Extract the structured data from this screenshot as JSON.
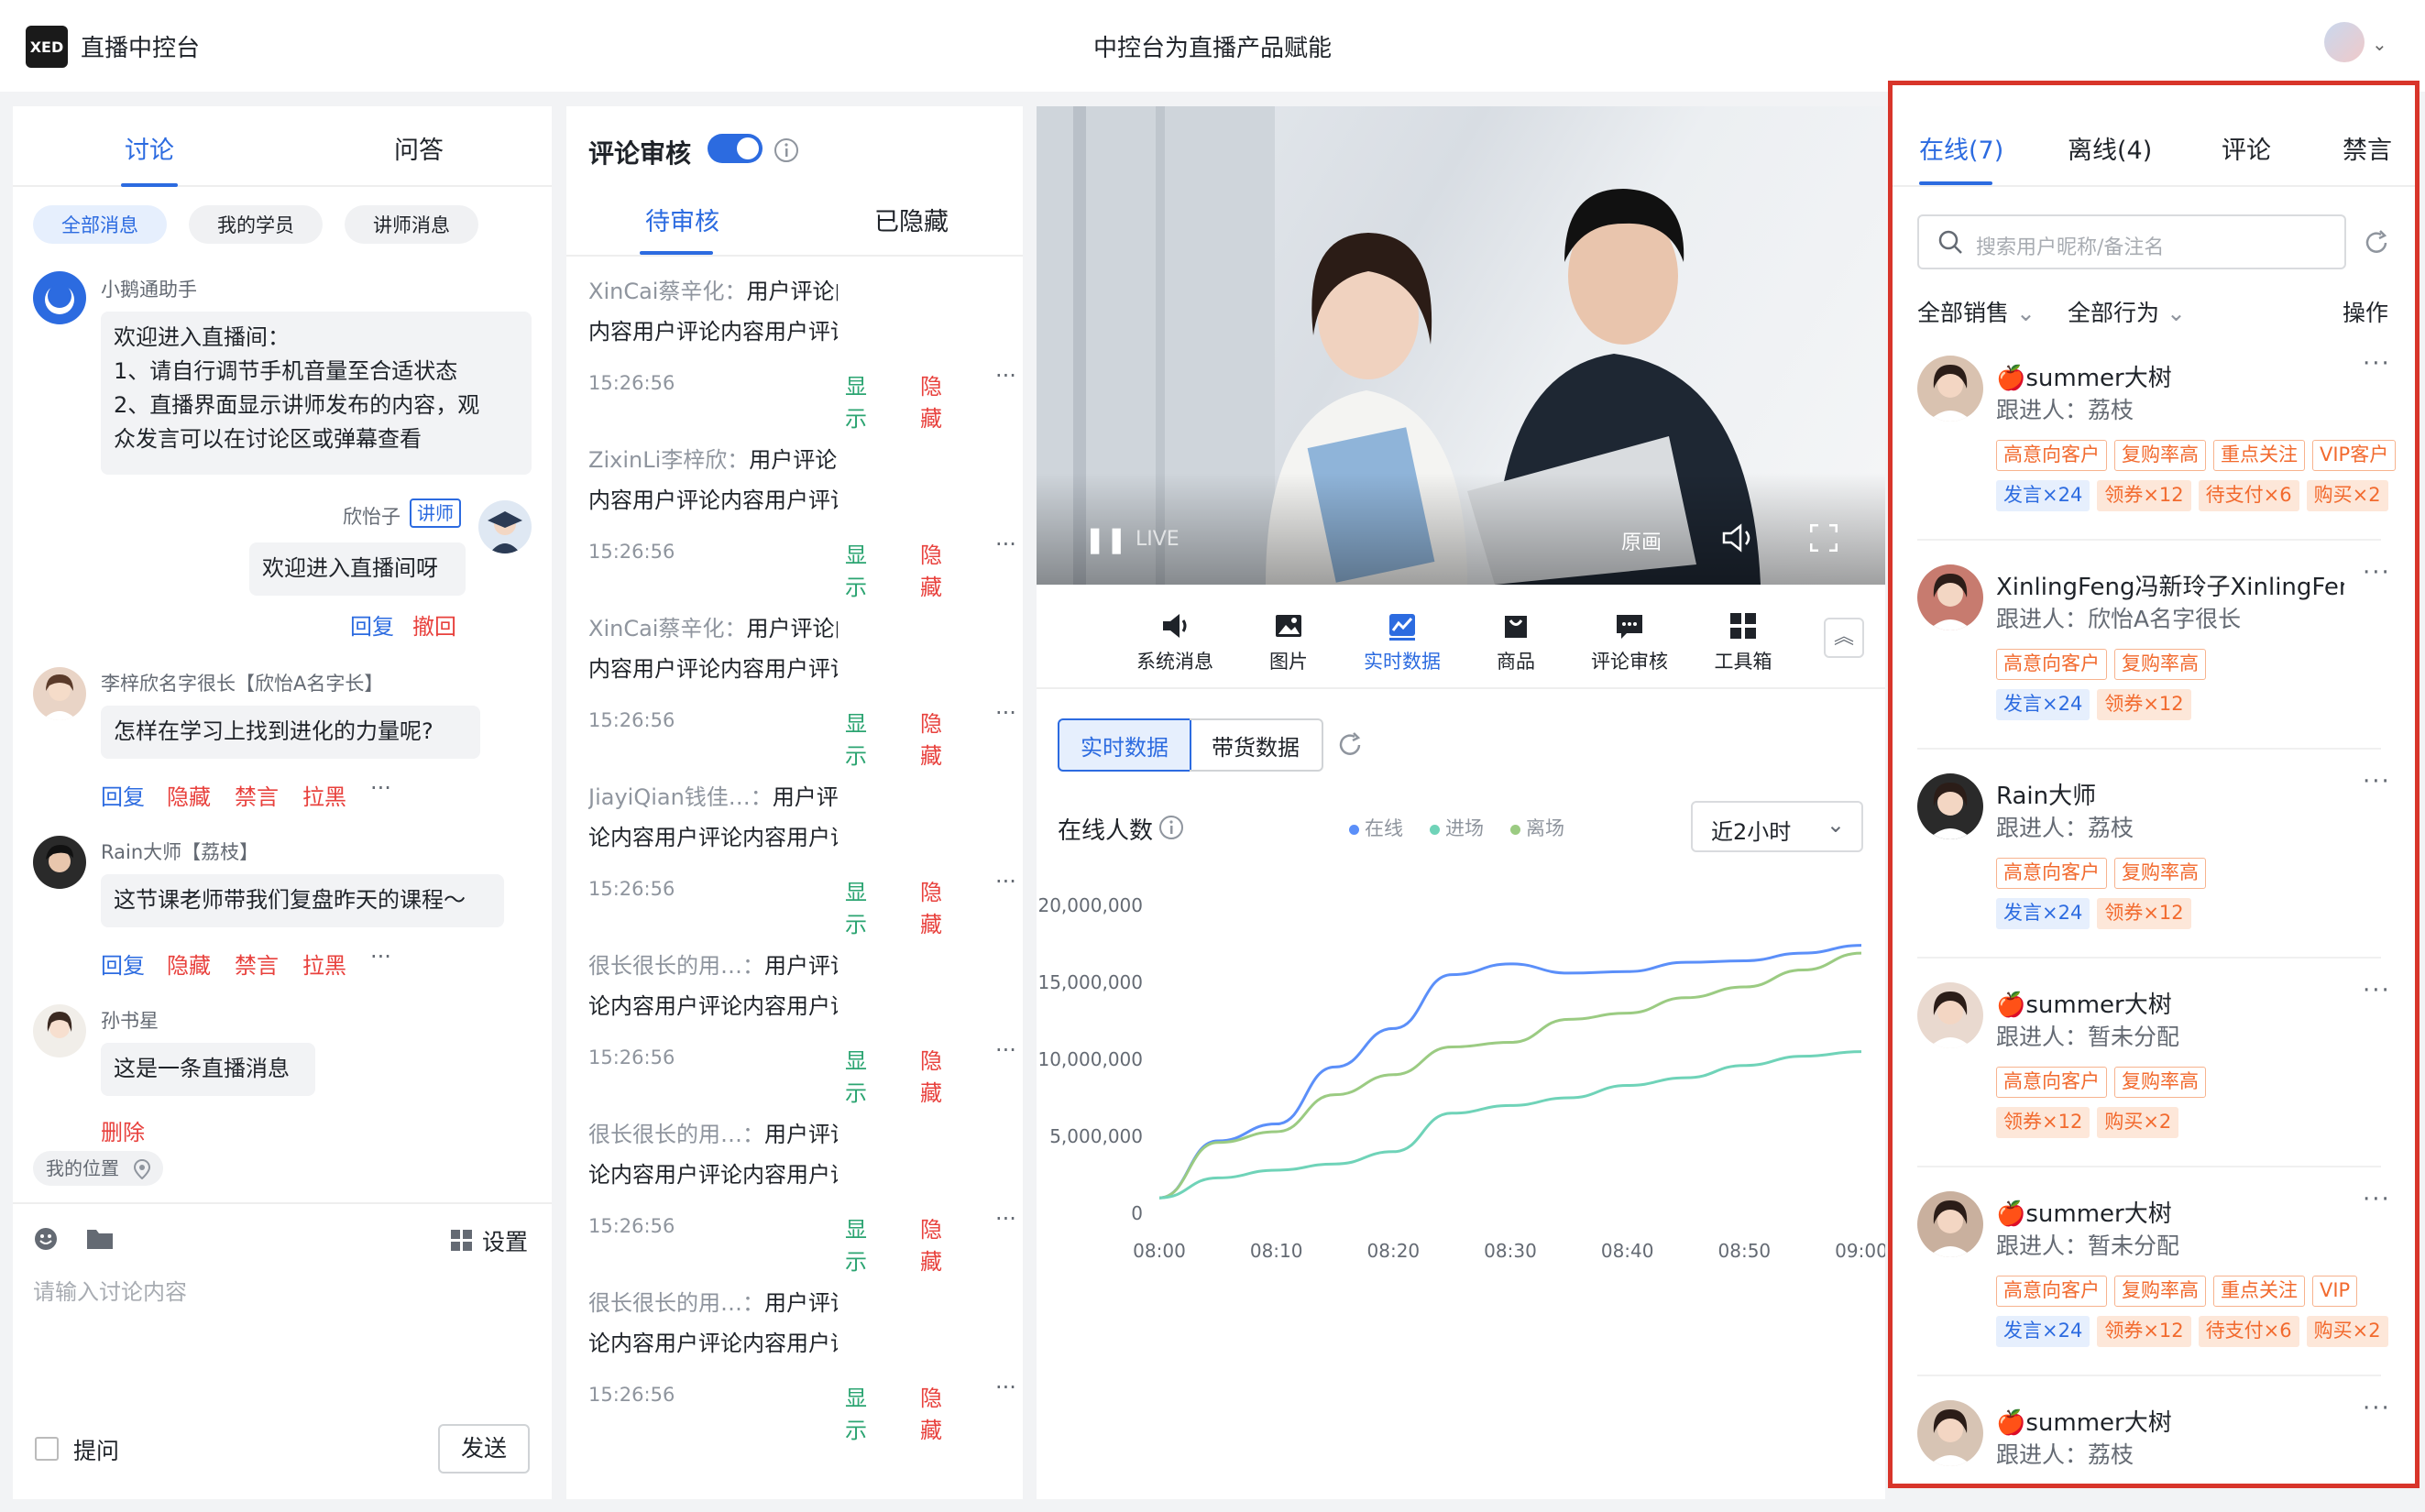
{
  "header": {
    "logo": "XED",
    "app_name": "直播中控台",
    "center_title": "中控台为直播产品赋能"
  },
  "discussion": {
    "tabs": [
      "讨论",
      "问答"
    ],
    "chips": [
      "全部消息",
      "我的学员",
      "讲师消息"
    ],
    "messages": [
      {
        "name": "小鹅通助手",
        "lines": [
          "欢迎进入直播间：",
          "1、请自行调节手机音量至合适状态",
          "2、直播界面显示讲师发布的内容，观",
          "众发言可以在讨论区或弹幕查看"
        ]
      },
      {
        "name": "欣怡子",
        "badge": "讲师",
        "text": "欢迎进入直播间呀",
        "actions": [
          "回复",
          "撤回"
        ]
      },
      {
        "name": "李梓欣名字很长【欣怡A名字长】",
        "text": "怎样在学习上找到进化的力量呢?",
        "actions": [
          "回复",
          "隐藏",
          "禁言",
          "拉黑"
        ]
      },
      {
        "name": "Rain大师【荔枝】",
        "text": "这节课老师带我们复盘昨天的课程～",
        "actions": [
          "回复",
          "隐藏",
          "禁言",
          "拉黑"
        ]
      },
      {
        "name": "孙书星",
        "text": "这是一条直播消息",
        "actions": [
          "删除"
        ]
      }
    ],
    "location": "我的位置",
    "settings": "设置",
    "input_placeholder": "请输入讨论内容",
    "ask_label": "提问",
    "send": "发送",
    "more": "···"
  },
  "review": {
    "title": "评论审核",
    "tabs": [
      "待审核",
      "已隐藏"
    ],
    "items": [
      {
        "name": "XinCai蔡辛化：",
        "l1": "用户评论内容用户评论",
        "l2": "内容用户评论内容用户评论内容用户…"
      },
      {
        "name": "ZixinLi李梓欣：",
        "l1": "用户评论内容用户评论",
        "l2": "内容用户评论内容用户评论内容用户…"
      },
      {
        "name": "XinCai蔡辛化：",
        "l1": "用户评论内容用户评论",
        "l2": "内容用户评论内容用户评论内容用户…"
      },
      {
        "name": "JiayiQian钱佳…：",
        "l1": "用户评论内容用户评",
        "l2": "论内容用户评论内容用户评论内容用…"
      },
      {
        "name": "很长很长的用…：",
        "l1": "用户评论内容用户评",
        "l2": "论内容用户评论内容用户评论内容用…"
      },
      {
        "name": "很长很长的用…：",
        "l1": "用户评论内容用户评",
        "l2": "论内容用户评论内容用户评论内容用…"
      },
      {
        "name": "很长很长的用…：",
        "l1": "用户评论内容用户评",
        "l2": "论内容用户评论内容用户评论内容用…"
      }
    ],
    "time": "15:26:56",
    "show": "显示",
    "hide": "隐藏",
    "more": "···"
  },
  "video": {
    "live": "LIVE",
    "quality": "原画"
  },
  "toolbar": {
    "items": [
      "系统消息",
      "图片",
      "实时数据",
      "商品",
      "评论审核",
      "工具箱"
    ],
    "active": "实时数据"
  },
  "data_tabs": [
    "实时数据",
    "带货数据"
  ],
  "chart_title": "在线人数",
  "range_select": "近2小时",
  "chart_data": {
    "type": "line",
    "x": [
      "08:00",
      "08:05",
      "08:10",
      "08:15",
      "08:20",
      "08:25",
      "08:30",
      "08:35",
      "08:40",
      "08:45",
      "08:50",
      "08:55",
      "09:00"
    ],
    "ylim": [
      0,
      20000000
    ],
    "yticks": [
      "20,000,000",
      "15,000,000",
      "10,000,000",
      "5,000,000",
      "0"
    ],
    "xticks": [
      "08:00",
      "08:10",
      "08:20",
      "08:30",
      "08:40",
      "08:50",
      "09:00"
    ],
    "series": [
      {
        "name": "在线",
        "color": "#5b8ff9",
        "values": [
          1000000,
          4700000,
          5800000,
          9500000,
          12000000,
          15500000,
          16200000,
          15600000,
          15700000,
          16300000,
          16400000,
          16900000,
          17400000
        ]
      },
      {
        "name": "进场",
        "color": "#9bcb82",
        "values": [
          1000000,
          4600000,
          5300000,
          7700000,
          9000000,
          10800000,
          11100000,
          12600000,
          13000000,
          14000000,
          14700000,
          15800000,
          16900000
        ]
      },
      {
        "name": "离场",
        "color": "#6fd3b8",
        "values": [
          1000000,
          2300000,
          2800000,
          3200000,
          4000000,
          6500000,
          7000000,
          7500000,
          8300000,
          8800000,
          9600000,
          10200000,
          10500000
        ]
      }
    ]
  },
  "online": {
    "tabs": [
      "在线(7)",
      "离线(4)",
      "评论",
      "禁言"
    ],
    "search_placeholder": "搜索用户昵称/备注名",
    "filters": [
      "全部销售",
      "全部行为"
    ],
    "operate": "操作",
    "users": [
      {
        "name": "🍎summer大树",
        "follow": "跟进人：荔枝",
        "tags1": [
          "高意向客户",
          "复购率高",
          "重点关注",
          "VIP客户"
        ],
        "tags2": [
          "发言×24",
          "领券×12",
          "待支付×6",
          "购买×2"
        ]
      },
      {
        "name": "XinlingFeng冯新玲子XinlingFeng冯新玲子",
        "follow": "跟进人：欣怡A名字很长",
        "tags1": [
          "高意向客户",
          "复购率高"
        ],
        "tags2": [
          "发言×24",
          "领券×12"
        ]
      },
      {
        "name": "Rain大师",
        "follow": "跟进人：荔枝",
        "tags1": [
          "高意向客户",
          "复购率高"
        ],
        "tags2": [
          "发言×24",
          "领券×12"
        ]
      },
      {
        "name": "🍎summer大树",
        "follow": "跟进人：暂未分配",
        "tags1": [
          "高意向客户",
          "复购率高"
        ],
        "tags2": [
          "领券×12",
          "购买×2"
        ]
      },
      {
        "name": "🍎summer大树",
        "follow": "跟进人：暂未分配",
        "tags1": [
          "高意向客户",
          "复购率高",
          "重点关注",
          "VIP"
        ],
        "tags2": [
          "发言×24",
          "领券×12",
          "待支付×6",
          "购买×2"
        ]
      },
      {
        "name": "🍎summer大树",
        "follow": "跟进人：荔枝",
        "tags1": [
          "高意向客户",
          "复购率高"
        ],
        "tags2": []
      }
    ],
    "more": "···"
  }
}
